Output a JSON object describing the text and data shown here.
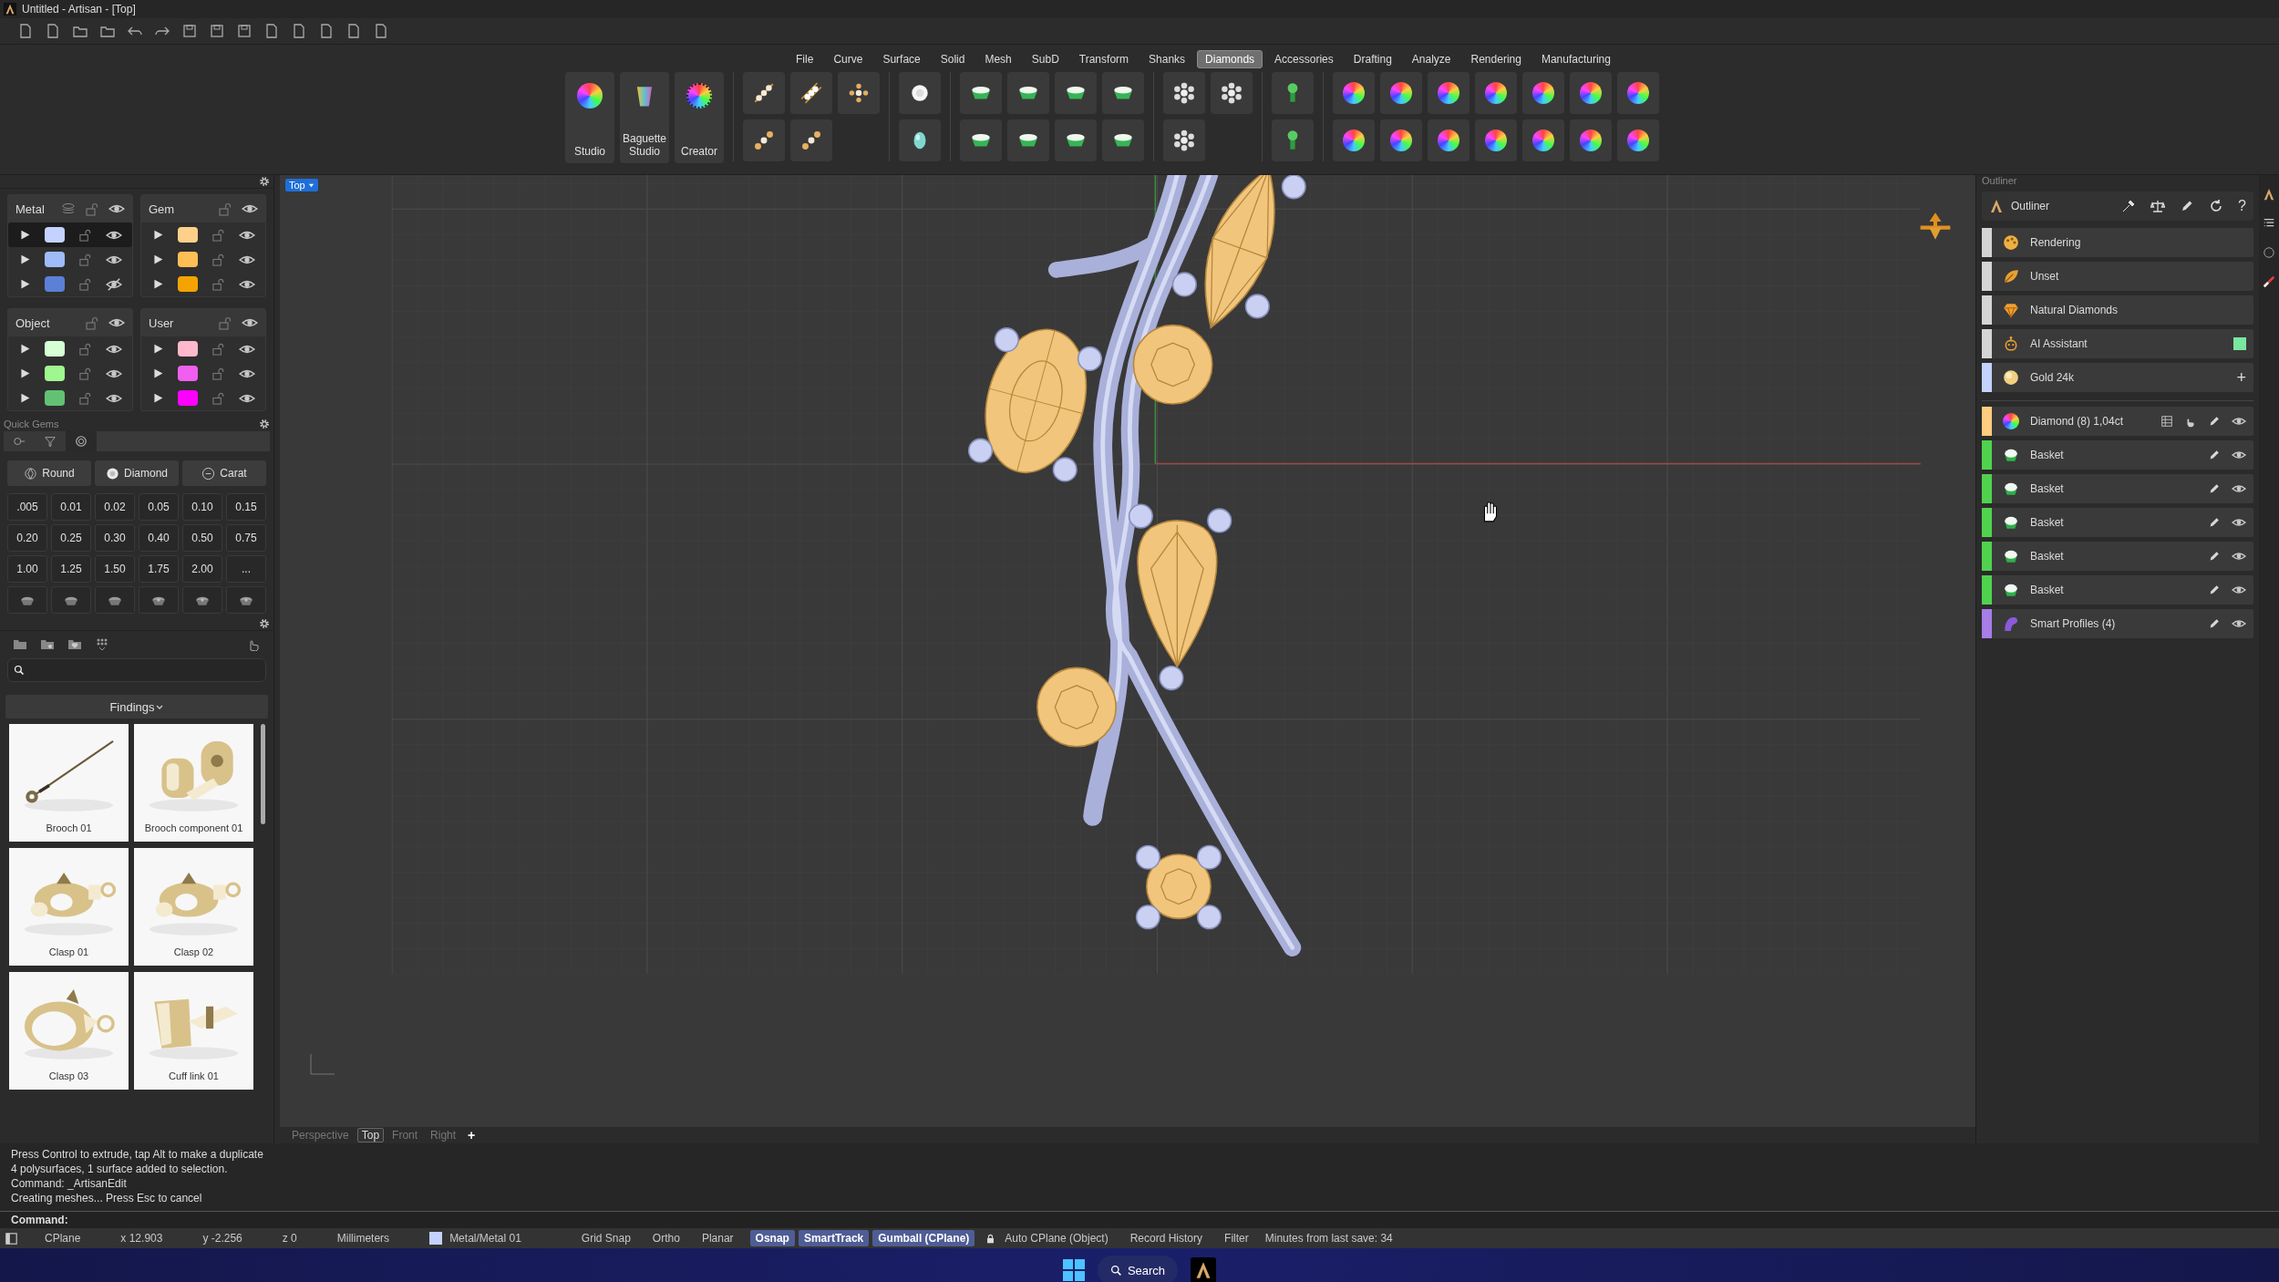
{
  "window": {
    "title": "Untitled - Artisan - [Top]"
  },
  "menu": [
    {
      "label": "File",
      "selected": false
    },
    {
      "label": "Curve",
      "selected": false
    },
    {
      "label": "Surface",
      "selected": false
    },
    {
      "label": "Solid",
      "selected": false
    },
    {
      "label": "Mesh",
      "selected": false
    },
    {
      "label": "SubD",
      "selected": false
    },
    {
      "label": "Transform",
      "selected": false
    },
    {
      "label": "Shanks",
      "selected": false
    },
    {
      "label": "Diamonds",
      "selected": true
    },
    {
      "label": "Accessories",
      "selected": false
    },
    {
      "label": "Drafting",
      "selected": false
    },
    {
      "label": "Analyze",
      "selected": false
    },
    {
      "label": "Rendering",
      "selected": false
    },
    {
      "label": "Manufacturing",
      "selected": false
    }
  ],
  "ribbon_tools": [
    {
      "label": "Studio",
      "kind": "wheel"
    },
    {
      "label": "Baguette Studio",
      "kind": "baguette"
    },
    {
      "label": "Creator",
      "kind": "dotted"
    }
  ],
  "layers": [
    {
      "name": "Metal",
      "rows": [
        {
          "color": "#c3d2ff",
          "visible": true,
          "selected": true
        },
        {
          "color": "#9fbcf8",
          "visible": true,
          "selected": false
        },
        {
          "color": "#5b80d6",
          "visible": false,
          "selected": false
        }
      ]
    },
    {
      "name": "Gem",
      "rows": [
        {
          "color": "#ffd08a",
          "visible": true,
          "selected": false
        },
        {
          "color": "#ffbf55",
          "visible": true,
          "selected": false
        },
        {
          "color": "#f5a300",
          "visible": true,
          "selected": false
        }
      ]
    },
    {
      "name": "Object",
      "rows": [
        {
          "color": "#d6ffd6",
          "visible": true,
          "selected": false
        },
        {
          "color": "#a0f790",
          "visible": true,
          "selected": false
        },
        {
          "color": "#62c274",
          "visible": true,
          "selected": false
        }
      ]
    },
    {
      "name": "User",
      "rows": [
        {
          "color": "#ffb8cc",
          "visible": true,
          "selected": false
        },
        {
          "color": "#f05ff0",
          "visible": true,
          "selected": false
        },
        {
          "color": "#ff00ff",
          "visible": true,
          "selected": false
        }
      ]
    }
  ],
  "quick_gems": {
    "title": "Quick Gems",
    "tabs": [
      {
        "selected": false
      },
      {
        "selected": false
      },
      {
        "selected": true
      }
    ],
    "dropdowns": [
      "Round",
      "Diamond",
      "Carat"
    ],
    "sizes": [
      ".005",
      "0.01",
      "0.02",
      "0.05",
      "0.10",
      "0.15",
      "0.20",
      "0.25",
      "0.30",
      "0.40",
      "0.50",
      "0.75",
      "1.00",
      "1.25",
      "1.50",
      "1.75",
      "2.00",
      "..."
    ]
  },
  "library": {
    "category": "Findings",
    "items": [
      {
        "label": "Brooch 01",
        "kind": "pin"
      },
      {
        "label": "Brooch component 01",
        "kind": "nut"
      },
      {
        "label": "Clasp 01",
        "kind": "clasp"
      },
      {
        "label": "Clasp 02",
        "kind": "clasp"
      },
      {
        "label": "Clasp 03",
        "kind": "ring"
      },
      {
        "label": "Cuff link 01",
        "kind": "cuff"
      }
    ]
  },
  "viewport": {
    "label": "Top",
    "tabs": [
      {
        "label": "Perspective",
        "selected": false
      },
      {
        "label": "Top",
        "selected": true
      },
      {
        "label": "Front",
        "selected": false
      },
      {
        "label": "Right",
        "selected": false
      }
    ],
    "add_tab": "+"
  },
  "outliner": {
    "panel_title": "Outliner",
    "title": "Outliner",
    "help": "?",
    "materials": [
      {
        "label": "Rendering",
        "kind": "palette",
        "color": "#d4d4d4",
        "on": false
      },
      {
        "label": "Unset",
        "kind": "leaf",
        "color": "#d4d4d4",
        "on": false
      },
      {
        "label": "Natural Diamonds",
        "kind": "diamond",
        "color": "#d4d4d4",
        "on": false
      },
      {
        "label": "AI Assistant",
        "kind": "robot",
        "color": "#d4d4d4",
        "on": true
      },
      {
        "label": "Gold 24k",
        "kind": "coin",
        "color": "#c3d2ff",
        "on": false,
        "action": "+"
      }
    ],
    "objects": [
      {
        "label": "Diamond (8) 1,04ct",
        "kind": "gem",
        "color": "#ffcc80",
        "visible": true
      },
      {
        "label": "Basket",
        "kind": "basket",
        "color": "#4fd34f",
        "visible": true
      },
      {
        "label": "Basket",
        "kind": "basket",
        "color": "#4fd34f",
        "visible": true
      },
      {
        "label": "Basket",
        "kind": "basket",
        "color": "#4fd34f",
        "visible": true
      },
      {
        "label": "Basket",
        "kind": "basket",
        "color": "#4fd34f",
        "visible": true
      },
      {
        "label": "Basket",
        "kind": "basket",
        "color": "#4fd34f",
        "visible": true
      },
      {
        "label": "Smart Profiles (4)",
        "kind": "profile",
        "color": "#a77de6",
        "visible": true
      }
    ]
  },
  "command": {
    "history": [
      "Press Control to extrude, tap Alt to make a duplicate",
      "4 polysurfaces, 1 surface added to selection.",
      "Command: _ArtisanEdit",
      "Creating meshes... Press Esc to cancel"
    ],
    "prompt": "Command:"
  },
  "status_bar": {
    "cplane": "CPlane",
    "coords": [
      "x 12.903",
      "y -2.256",
      "z 0"
    ],
    "units": "Millimeters",
    "layer": {
      "label": "Metal/Metal 01",
      "color": "#c3d2ff"
    },
    "toggles": [
      {
        "label": "Grid Snap",
        "on": false
      },
      {
        "label": "Ortho",
        "on": false
      },
      {
        "label": "Planar",
        "on": false
      },
      {
        "label": "Osnap",
        "on": true
      },
      {
        "label": "SmartTrack",
        "on": true
      },
      {
        "label": "Gumball (CPlane)",
        "on": true
      }
    ],
    "extras": [
      "Auto CPlane (Object)",
      "Record History",
      "Filter"
    ],
    "save_info": "Minutes from last save: 34"
  },
  "taskbar": {
    "search": "Search"
  }
}
